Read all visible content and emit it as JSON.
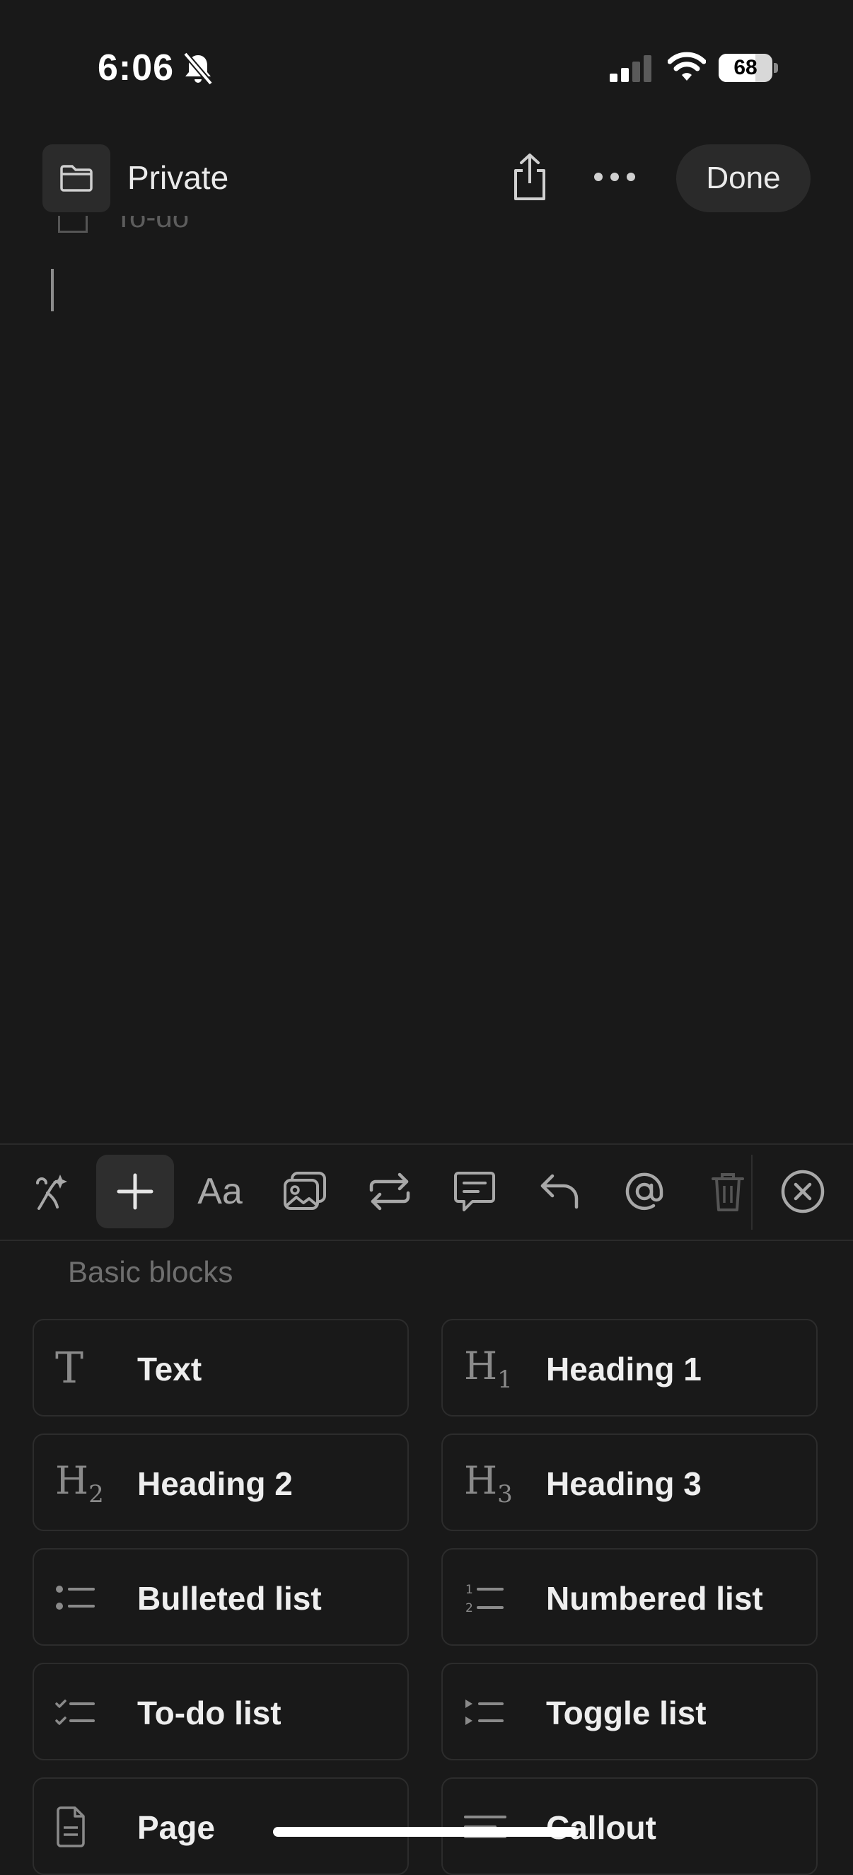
{
  "status_bar": {
    "time": "6:06",
    "battery_percent": "68",
    "battery_level": 0.68
  },
  "nav": {
    "folder_label": "Private",
    "done_label": "Done"
  },
  "editor": {
    "todo_placeholder": "To-do"
  },
  "toolbar": {
    "tools": [
      "ai-icon",
      "add-block-icon",
      "text-style-icon",
      "media-icon",
      "turn-into-icon",
      "comment-icon",
      "undo-icon",
      "mention-icon",
      "delete-icon",
      "close-icon"
    ],
    "text_style_label": "Aa"
  },
  "blocks": {
    "section_label": "Basic blocks",
    "items": [
      {
        "label": "Text",
        "icon": "text-icon"
      },
      {
        "label": "Heading 1",
        "icon": "heading-1-icon"
      },
      {
        "label": "Heading 2",
        "icon": "heading-2-icon"
      },
      {
        "label": "Heading 3",
        "icon": "heading-3-icon"
      },
      {
        "label": "Bulleted list",
        "icon": "bulleted-list-icon"
      },
      {
        "label": "Numbered list",
        "icon": "numbered-list-icon"
      },
      {
        "label": "To-do list",
        "icon": "todo-list-icon"
      },
      {
        "label": "Toggle list",
        "icon": "toggle-list-icon"
      },
      {
        "label": "Page",
        "icon": "page-icon"
      },
      {
        "label": "Callout",
        "icon": "callout-icon"
      }
    ]
  },
  "colors": {
    "background": "#191919",
    "card_border": "#2c2c2c",
    "icon_gray": "#8a8a8a"
  }
}
